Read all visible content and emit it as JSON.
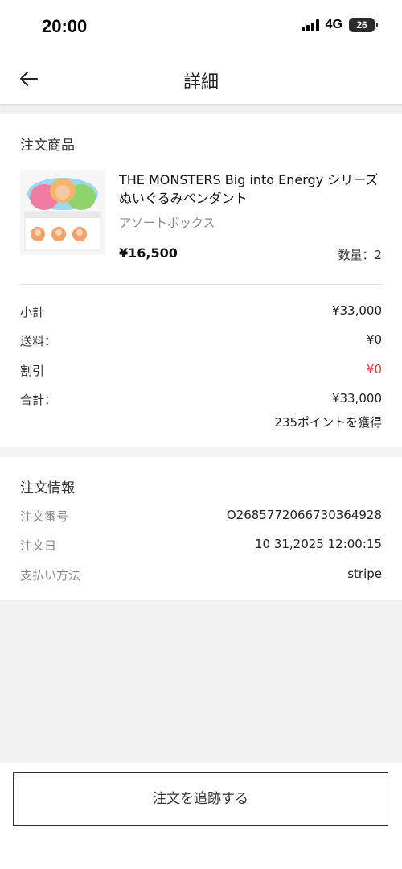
{
  "status_bar": {
    "time": "20:00",
    "network": "4G",
    "battery": "26"
  },
  "header": {
    "title": "詳細",
    "back_icon": "arrow-left-icon"
  },
  "products_section": {
    "title": "注文商品",
    "product": {
      "name": "THE MONSTERS Big into Energy シリーズ ぬいぐるみペンダント",
      "variant": "アソートボックス",
      "price": "¥16,500",
      "quantity": "数量：2"
    },
    "summary": {
      "subtotal_label": "小計",
      "subtotal_value": "¥33,000",
      "shipping_label": "送料：",
      "shipping_value": "¥0",
      "discount_label": "割引",
      "discount_value": "¥0",
      "total_label": "合計：",
      "total_value": "¥33,000",
      "points": "235ポイントを獲得"
    }
  },
  "order_info": {
    "title": "注文情報",
    "order_number_label": "注文番号",
    "order_number_value": "O2685772066730364928",
    "order_date_label": "注文日",
    "order_date_value": "10 31,2025 12:00:15",
    "payment_label": "支払い方法",
    "payment_value": "stripe"
  },
  "footer": {
    "track_button": "注文を追跡する"
  },
  "colors": {
    "accent_red": "#e4393c",
    "background": "#f2f2f2"
  }
}
